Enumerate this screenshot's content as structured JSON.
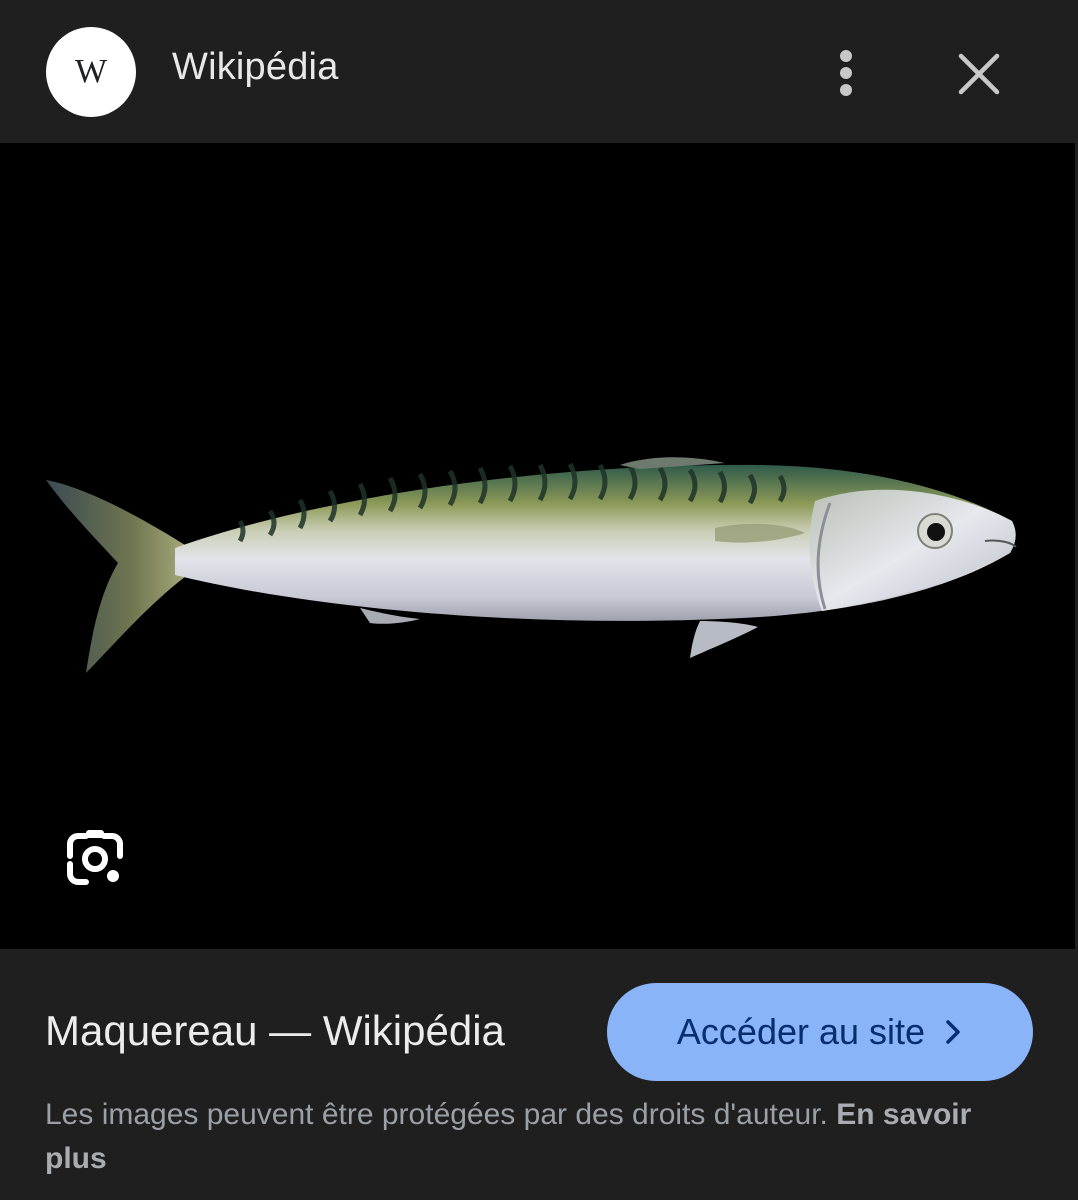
{
  "header": {
    "logo_letter": "W",
    "site_name": "Wikipédia",
    "menu_icon": "more-vert-icon",
    "close_icon": "close-icon"
  },
  "viewer": {
    "image_subject": "mackerel-fish",
    "lens_icon": "google-lens-icon",
    "background": "#000000"
  },
  "footer": {
    "title": "Maquereau — Wikipédia",
    "visit_label": "Accéder au site",
    "visit_icon": "chevron-right-icon",
    "notice_text": "Les images peuvent être protégées par des droits d'auteur.",
    "learn_more_label": "En savoir plus"
  },
  "colors": {
    "accent": "#8ab4f8",
    "panel": "#1f1f1f"
  }
}
